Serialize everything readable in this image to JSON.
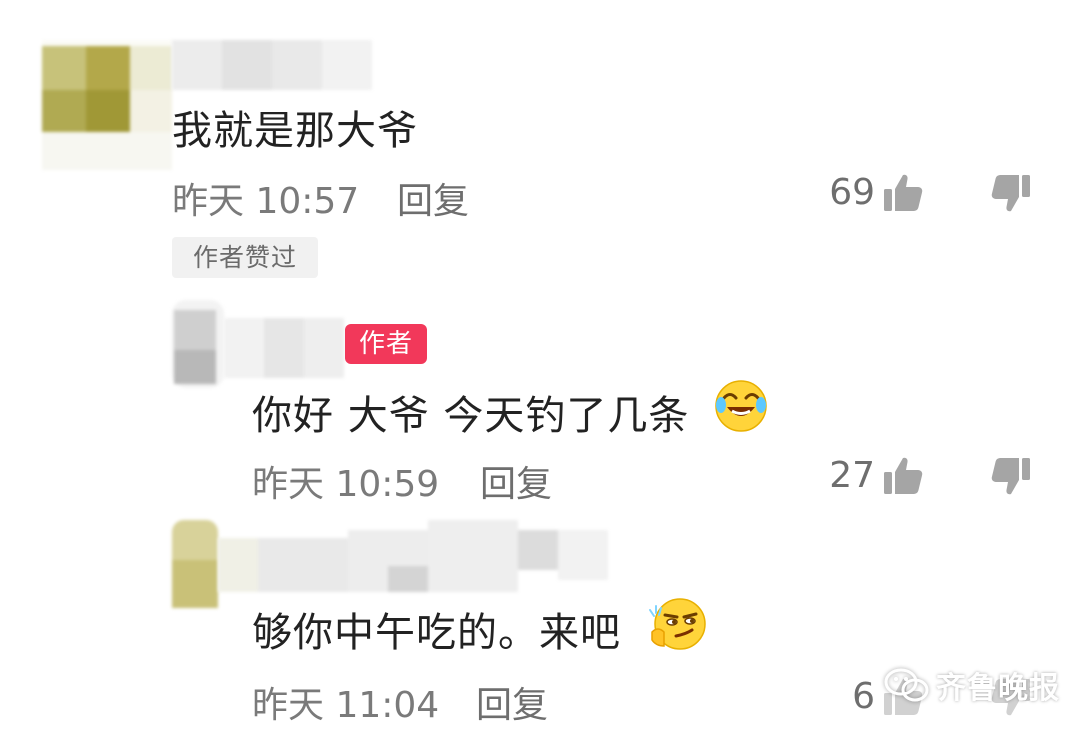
{
  "comments": [
    {
      "text": "我就是那大爷",
      "time": "昨天 10:57",
      "reply_label": "回复",
      "likes": "69",
      "tag": "作者赞过"
    },
    {
      "badge": "作者",
      "text": "你好 大爷 今天钓了几条",
      "emoji": "crying-laughing-emoji",
      "time": "昨天 10:59",
      "reply_label": "回复",
      "likes": "27"
    },
    {
      "text": "够你中午吃的。来吧",
      "emoji": "smirk-emoji",
      "time": "昨天 11:04",
      "reply_label": "回复",
      "likes": "6"
    }
  ],
  "watermark": "齐鲁晚报",
  "icons": {
    "like": "thumbs-up-icon",
    "dislike": "thumbs-down-icon"
  },
  "colors": {
    "author_badge": "#f2385a",
    "meta_text": "#7a7a7a"
  }
}
